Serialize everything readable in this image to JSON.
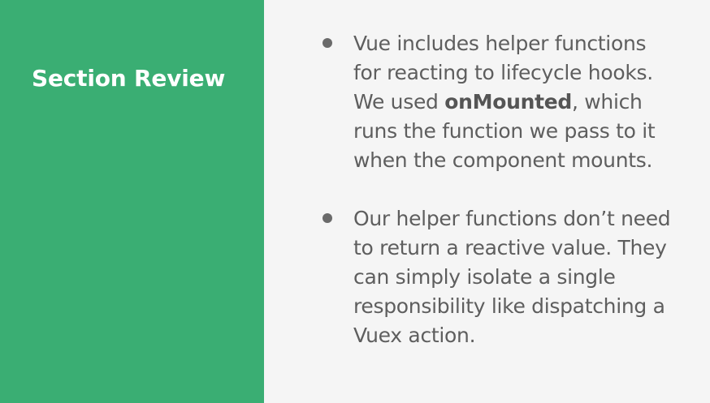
{
  "slide": {
    "title": "Section Review",
    "bullets": [
      {
        "lines": [
          {
            "text": "Vue includes helper functions"
          },
          {
            "text": "for reacting to lifecycle hooks."
          },
          {
            "before": "We used ",
            "bold": "onMounted",
            "after": ", which"
          },
          {
            "text": "runs the function we pass to it"
          },
          {
            "text": "when the component mounts."
          }
        ]
      },
      {
        "lines": [
          {
            "text": "Our helper functions don’t need"
          },
          {
            "text": "to return a reactive value. They"
          },
          {
            "text": "can simply isolate a single"
          },
          {
            "text": "responsibility like dispatching a"
          },
          {
            "text": "Vuex action."
          }
        ]
      }
    ]
  },
  "colors": {
    "accent_panel": "#3aae73",
    "background": "#f5f5f5",
    "body_text": "#5e5e5e",
    "title_text": "#ffffff"
  }
}
